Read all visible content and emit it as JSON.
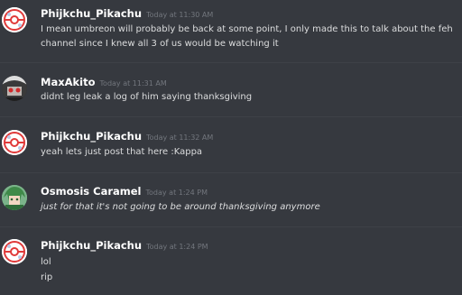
{
  "messages": [
    {
      "author": "Phijkchu_Pikachu",
      "avatar": "pokeball-flower-icon",
      "timestamp": "Today at 11:30 AM",
      "lines": [
        "I mean umbreon will probably be back at some point, I only made this to talk about the feh",
        "channel since I knew all 3 of us would be watching it"
      ]
    },
    {
      "author": "MaxAkito",
      "avatar": "red-eyed-character-icon",
      "timestamp": "Today at 11:31 AM",
      "lines": [
        "didnt leg leak a log of him saying thanksgiving"
      ]
    },
    {
      "author": "Phijkchu_Pikachu",
      "avatar": "pokeball-flower-icon",
      "timestamp": "Today at 11:32 AM",
      "lines": [
        "yeah lets just post that here :Kappa"
      ]
    },
    {
      "author": "Osmosis Caramel",
      "avatar": "green-hair-character-icon",
      "timestamp": "Today at 1:24 PM",
      "lines": [
        "just for that it's not going to be around thanksgiving anymore"
      ]
    },
    {
      "author": "Phijkchu_Pikachu",
      "avatar": "pokeball-flower-icon",
      "timestamp": "Today at 1:24 PM",
      "lines": [
        "lol",
        "rip"
      ]
    }
  ],
  "colors": {
    "background": "#36393f",
    "username": "#ffffff",
    "timestamp": "#72767d",
    "text": "#dcddde"
  }
}
